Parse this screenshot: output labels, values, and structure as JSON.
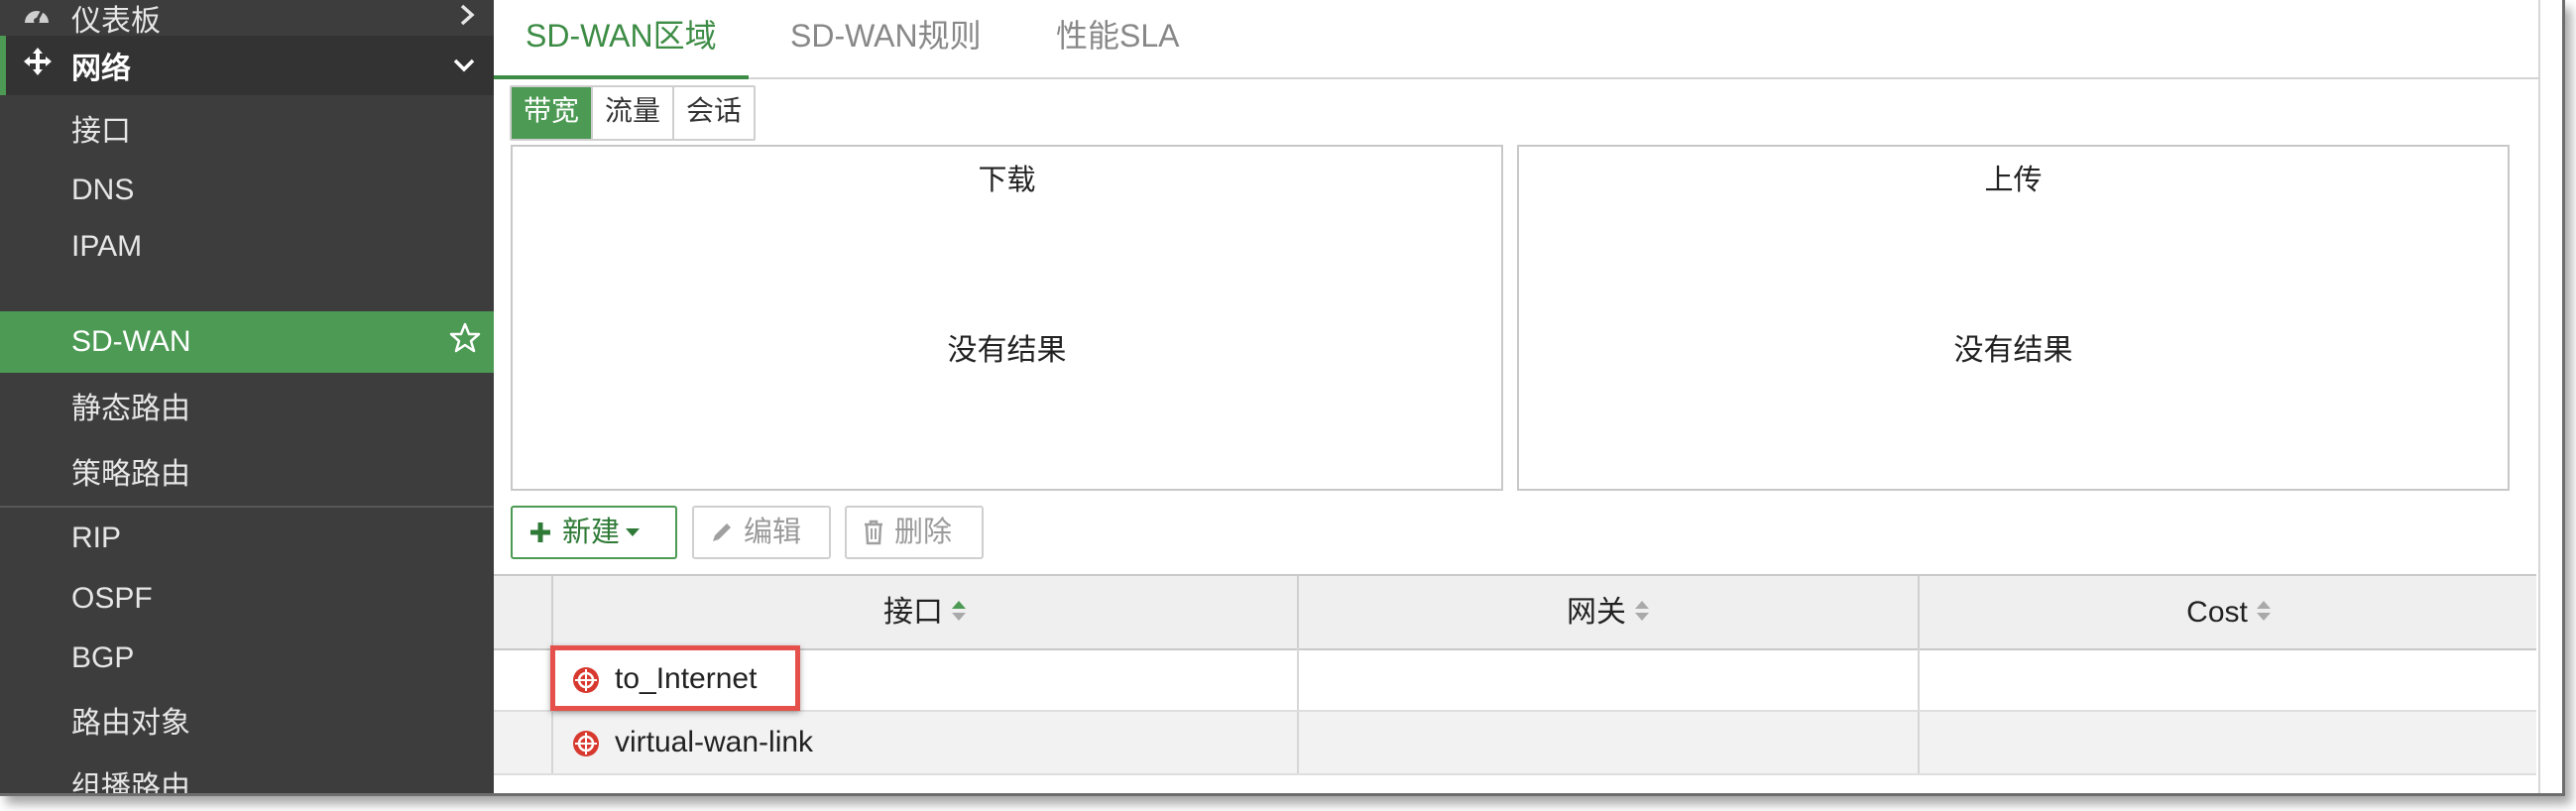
{
  "sidebar": {
    "dashboard": "仪表板",
    "network": "网络",
    "items": [
      "接口",
      "DNS",
      "IPAM",
      "SD-WAN",
      "静态路由",
      "策略路由",
      "RIP",
      "OSPF",
      "BGP",
      "路由对象",
      "组播路由"
    ]
  },
  "tabs": [
    "SD-WAN区域",
    "SD-WAN规则",
    "性能SLA"
  ],
  "segments": [
    "带宽",
    "流量",
    "会话"
  ],
  "panels": {
    "download": {
      "title": "下载",
      "empty": "没有结果"
    },
    "upload": {
      "title": "上传",
      "empty": "没有结果"
    }
  },
  "toolbar": {
    "new": "新建",
    "edit": "编辑",
    "delete": "删除"
  },
  "table": {
    "columns": [
      "接口",
      "网关",
      "Cost"
    ],
    "rows": [
      {
        "interface": "to_Internet",
        "gateway": "",
        "cost": ""
      },
      {
        "interface": "virtual-wan-link",
        "gateway": "",
        "cost": ""
      }
    ]
  },
  "colors": {
    "accent": "#4c9a53",
    "sidebar_bg": "#3d3d3d",
    "highlight": "#e5514a"
  }
}
